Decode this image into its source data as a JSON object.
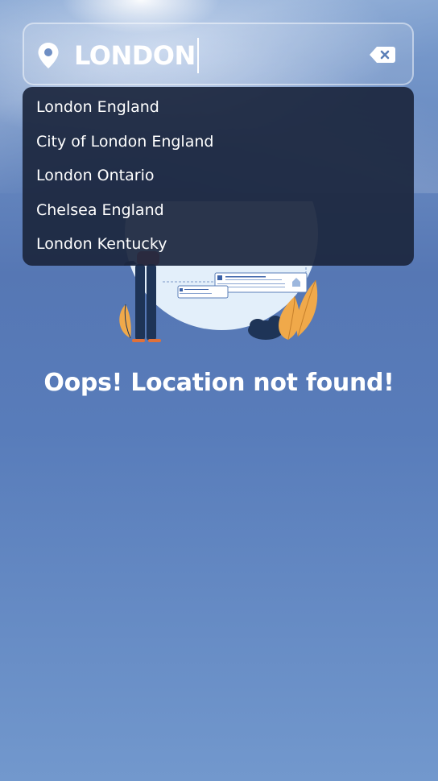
{
  "search": {
    "value": "LONDON",
    "location_icon": "map-pin-icon",
    "clear_icon": "backspace-clear-icon"
  },
  "suggestions": [
    {
      "label": "London England"
    },
    {
      "label": "City of London England"
    },
    {
      "label": "London Ontario"
    },
    {
      "label": "Chelsea England"
    },
    {
      "label": "London Kentucky"
    }
  ],
  "status": {
    "message": "Oops! Location not found!"
  },
  "colors": {
    "sky_top": "#7d9fcf",
    "sky_mid": "#5677b4",
    "sky_bottom": "#7298cd",
    "dropdown_bg": "#1c273e",
    "illustration_circle": "#e3effa",
    "plant_orange": "#f0a94a",
    "plant_navy": "#1e3457"
  }
}
